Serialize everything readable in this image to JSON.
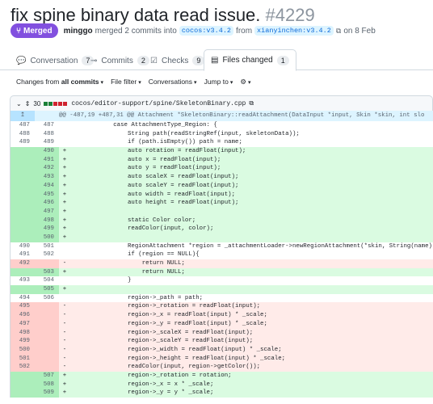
{
  "pr": {
    "title": "fix spine binary data read issue.",
    "number": "#4229",
    "state": "Merged",
    "author": "minggo",
    "action": "merged 2 commits into",
    "base_branch": "cocos:v3.4.2",
    "from_word": "from",
    "head_branch": "xianyinchen:v3.4.2",
    "date": "on 8 Feb"
  },
  "tabs": [
    {
      "label": "Conversation",
      "count": "7"
    },
    {
      "label": "Commits",
      "count": "2"
    },
    {
      "label": "Checks",
      "count": "9"
    },
    {
      "label": "Files changed",
      "count": "1"
    }
  ],
  "filters": {
    "changes_prefix": "Changes from",
    "changes_value": "all commits",
    "file_filter": "File filter",
    "conversations": "Conversations",
    "jump_to": "Jump to"
  },
  "file": {
    "changes": "30",
    "path": "cocos/editor-support/spine/SkeletonBinary.cpp",
    "stat_colors": [
      "#1a7f37",
      "#1a7f37",
      "#cf222e",
      "#cf222e",
      "#cf222e"
    ]
  },
  "hunk": "@@ -487,19 +487,31 @@ Attachment *SkeletonBinary::readAttachment(DataInput *input, Skin *skin, int slo",
  "lines": [
    {
      "t": "ctx",
      "o": "487",
      "n": "487",
      "c": "            case AttachmentType_Region: {"
    },
    {
      "t": "ctx",
      "o": "488",
      "n": "488",
      "c": "                String path(readStringRef(input, skeletonData));"
    },
    {
      "t": "ctx",
      "o": "489",
      "n": "489",
      "c": "                if (path.isEmpty()) path = name;"
    },
    {
      "t": "add",
      "o": "",
      "n": "490",
      "c": "                auto rotation = readFloat(input);"
    },
    {
      "t": "add",
      "o": "",
      "n": "491",
      "c": "                auto x = readFloat(input);"
    },
    {
      "t": "add",
      "o": "",
      "n": "492",
      "c": "                auto y = readFloat(input);"
    },
    {
      "t": "add",
      "o": "",
      "n": "493",
      "c": "                auto scaleX = readFloat(input);"
    },
    {
      "t": "add",
      "o": "",
      "n": "494",
      "c": "                auto scaleY = readFloat(input);"
    },
    {
      "t": "add",
      "o": "",
      "n": "495",
      "c": "                auto width = readFloat(input);"
    },
    {
      "t": "add",
      "o": "",
      "n": "496",
      "c": "                auto height = readFloat(input);"
    },
    {
      "t": "add",
      "o": "",
      "n": "497",
      "c": ""
    },
    {
      "t": "add",
      "o": "",
      "n": "498",
      "c": "                static Color color;"
    },
    {
      "t": "add",
      "o": "",
      "n": "499",
      "c": "                readColor(input, color);"
    },
    {
      "t": "add",
      "o": "",
      "n": "500",
      "c": ""
    },
    {
      "t": "ctx",
      "o": "490",
      "n": "501",
      "c": "                RegionAttachment *region = _attachmentLoader->newRegionAttachment(*skin, String(name), String(path));"
    },
    {
      "t": "ctx",
      "o": "491",
      "n": "502",
      "c": "                if (region == NULL){"
    },
    {
      "t": "del",
      "o": "492",
      "n": "",
      "c": "                    return NULL;"
    },
    {
      "t": "add",
      "o": "",
      "n": "503",
      "c": "                    return NULL;"
    },
    {
      "t": "ctx",
      "o": "493",
      "n": "504",
      "c": "                }"
    },
    {
      "t": "add",
      "o": "",
      "n": "505",
      "c": ""
    },
    {
      "t": "ctx",
      "o": "494",
      "n": "506",
      "c": "                region->_path = path;"
    },
    {
      "t": "del",
      "o": "495",
      "n": "",
      "c": "                region->_rotation = readFloat(input);"
    },
    {
      "t": "del",
      "o": "496",
      "n": "",
      "c": "                region->_x = readFloat(input) * _scale;"
    },
    {
      "t": "del",
      "o": "497",
      "n": "",
      "c": "                region->_y = readFloat(input) * _scale;"
    },
    {
      "t": "del",
      "o": "498",
      "n": "",
      "c": "                region->_scaleX = readFloat(input);"
    },
    {
      "t": "del",
      "o": "499",
      "n": "",
      "c": "                region->_scaleY = readFloat(input);"
    },
    {
      "t": "del",
      "o": "500",
      "n": "",
      "c": "                region->_width = readFloat(input) * _scale;"
    },
    {
      "t": "del",
      "o": "501",
      "n": "",
      "c": "                region->_height = readFloat(input) * _scale;"
    },
    {
      "t": "del",
      "o": "502",
      "n": "",
      "c": "                readColor(input, region->getColor());"
    },
    {
      "t": "add",
      "o": "",
      "n": "507",
      "c": "                region->_rotation = rotation;"
    },
    {
      "t": "add",
      "o": "",
      "n": "508",
      "c": "                region->_x = x * _scale;"
    },
    {
      "t": "add",
      "o": "",
      "n": "509",
      "c": "                region->_y = y * _scale;"
    }
  ]
}
